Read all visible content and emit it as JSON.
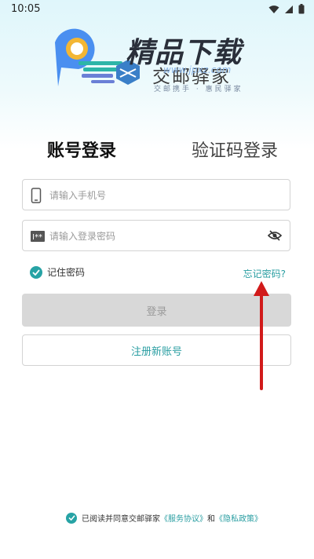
{
  "status_bar": {
    "time": "10:05"
  },
  "logo": {
    "title": "精品下载",
    "subtitle": "交邮驿家",
    "tagline": "交邮携手 · 惠民驿家",
    "watermark": "www.jpxz.com"
  },
  "tabs": [
    {
      "label": "账号登录",
      "active": true
    },
    {
      "label": "验证码登录",
      "active": false
    }
  ],
  "phone_field": {
    "placeholder": "请输入手机号",
    "value": ""
  },
  "password_field": {
    "placeholder": "请输入登录密码",
    "value": ""
  },
  "remember": {
    "label": "记住密码",
    "checked": true
  },
  "forgot_password": "忘记密码?",
  "login_button": "登录",
  "register_button": "注册新账号",
  "agreement": {
    "prefix": "已阅读并同意交邮驿家",
    "service_link": "《服务协议》",
    "and": "和",
    "privacy_link": "《隐私政策》",
    "checked": true
  },
  "colors": {
    "accent": "#2a9ea2",
    "check": "#27a3a5",
    "arrow": "#d11a1a"
  }
}
